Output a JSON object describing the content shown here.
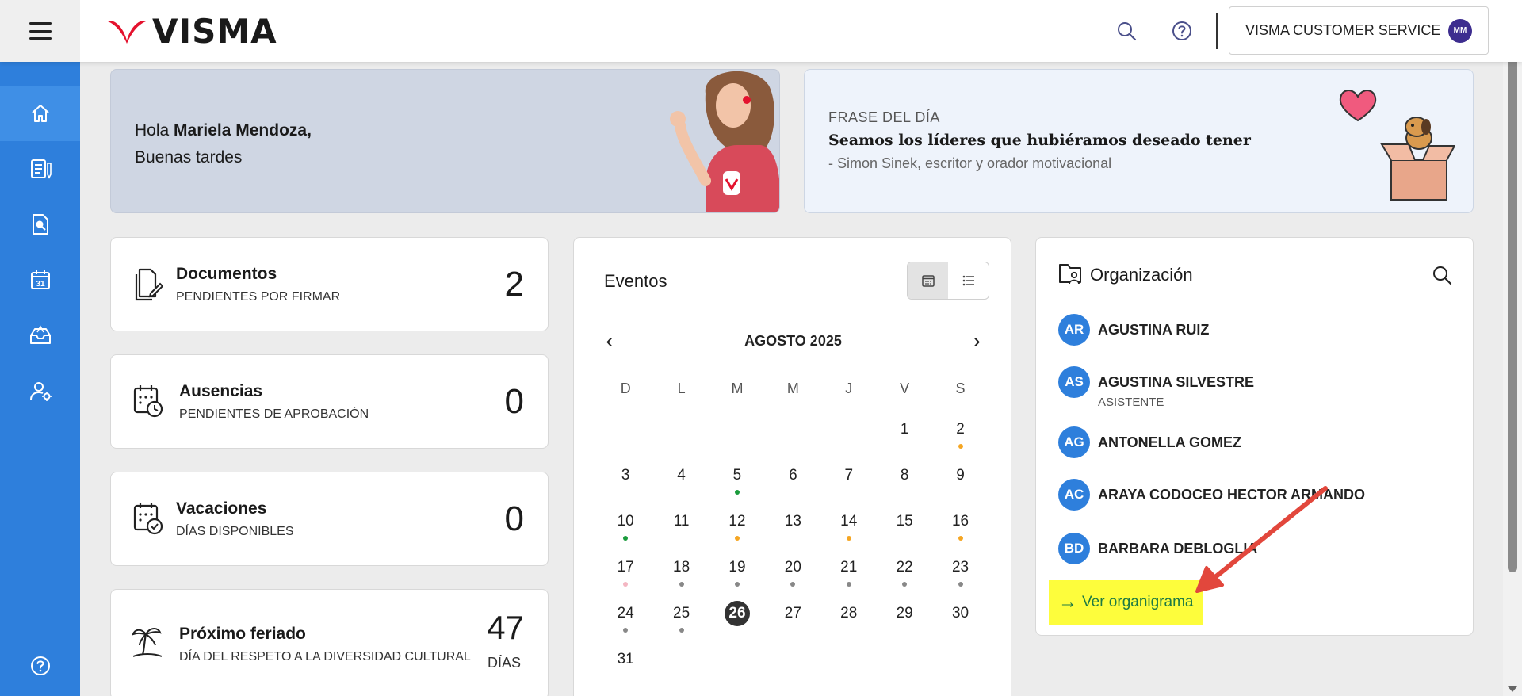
{
  "header": {
    "logo_text": "VISMA",
    "user_name": "VISMA CUSTOMER SERVICE",
    "user_initials": "MM",
    "icons": [
      "search-icon",
      "help-icon"
    ]
  },
  "sidebar": {
    "items": [
      "home-icon",
      "documents-icon",
      "search-document-icon",
      "calendar-icon",
      "inbox-icon",
      "user-settings-icon",
      "help-icon"
    ]
  },
  "greeting": {
    "hello": "Hola",
    "name": "Mariela Mendoza,",
    "subtitle": "Buenas tardes"
  },
  "phrase": {
    "title": "FRASE DEL DÍA",
    "quote": "Seamos los líderes que hubiéramos deseado tener",
    "author": "- Simon Sinek, escritor y orador motivacional"
  },
  "stats": {
    "documents": {
      "title": "Documentos",
      "subtitle": "PENDIENTES POR FIRMAR",
      "value": "2"
    },
    "absences": {
      "title": "Ausencias",
      "subtitle": "PENDIENTES DE APROBACIÓN",
      "value": "0"
    },
    "vacations": {
      "title": "Vacaciones",
      "subtitle": "DÍAS DISPONIBLES",
      "value": "0"
    },
    "holiday": {
      "title": "Próximo feriado",
      "subtitle": "DÍA DEL RESPETO A LA DIVERSIDAD CULTURAL",
      "value": "47",
      "unit": "DÍAS"
    }
  },
  "events": {
    "title": "Eventos",
    "prev": "‹",
    "next": "›",
    "month": "AGOSTO 2025",
    "weekdays": [
      "D",
      "L",
      "M",
      "M",
      "J",
      "V",
      "S"
    ],
    "weeks": [
      [
        {
          "d": ""
        },
        {
          "d": ""
        },
        {
          "d": ""
        },
        {
          "d": ""
        },
        {
          "d": ""
        },
        {
          "d": "1"
        },
        {
          "d": "2",
          "dot": "#f5a623"
        }
      ],
      [
        {
          "d": "3"
        },
        {
          "d": "4"
        },
        {
          "d": "5",
          "dot": "#1a9b3c"
        },
        {
          "d": "6"
        },
        {
          "d": "7"
        },
        {
          "d": "8"
        },
        {
          "d": "9"
        }
      ],
      [
        {
          "d": "10",
          "dot": "#1a9b3c"
        },
        {
          "d": "11"
        },
        {
          "d": "12",
          "dot": "#f5a623"
        },
        {
          "d": "13"
        },
        {
          "d": "14",
          "dot": "#f5a623"
        },
        {
          "d": "15"
        },
        {
          "d": "16",
          "dot": "#f5a623"
        }
      ],
      [
        {
          "d": "17",
          "dot": "#f4b6c2"
        },
        {
          "d": "18",
          "dot": "#888888"
        },
        {
          "d": "19",
          "dot": "#888888"
        },
        {
          "d": "20",
          "dot": "#888888"
        },
        {
          "d": "21",
          "dot": "#888888"
        },
        {
          "d": "22",
          "dot": "#888888"
        },
        {
          "d": "23",
          "dot": "#888888"
        }
      ],
      [
        {
          "d": "24",
          "dot": "#888888"
        },
        {
          "d": "25",
          "dot": "#888888"
        },
        {
          "d": "26",
          "today": true
        },
        {
          "d": "27"
        },
        {
          "d": "28"
        },
        {
          "d": "29"
        },
        {
          "d": "30"
        }
      ],
      [
        {
          "d": "31"
        },
        {
          "d": ""
        },
        {
          "d": ""
        },
        {
          "d": ""
        },
        {
          "d": ""
        },
        {
          "d": ""
        },
        {
          "d": ""
        }
      ]
    ]
  },
  "organization": {
    "title": "Organización",
    "people": [
      {
        "initials": "AR",
        "name": "AGUSTINA RUIZ",
        "role": ""
      },
      {
        "initials": "AS",
        "name": "AGUSTINA SILVESTRE",
        "role": "ASISTENTE"
      },
      {
        "initials": "AG",
        "name": "ANTONELLA GOMEZ",
        "role": ""
      },
      {
        "initials": "AC",
        "name": "ARAYA CODOCEO HECTOR ARMANDO",
        "role": ""
      },
      {
        "initials": "BD",
        "name": "BARBARA DEBLOGLIA",
        "role": ""
      }
    ],
    "link_arrow": "→",
    "link_label": "Ver organigrama"
  },
  "colors": {
    "brand_red": "#e4122e",
    "sidebar_blue": "#2e7fdc",
    "avatar_blue": "#2e7fdc",
    "highlight_yellow": "#fdfd3c",
    "link_green": "#1e7a44",
    "annotation_arrow": "#e2473c"
  }
}
